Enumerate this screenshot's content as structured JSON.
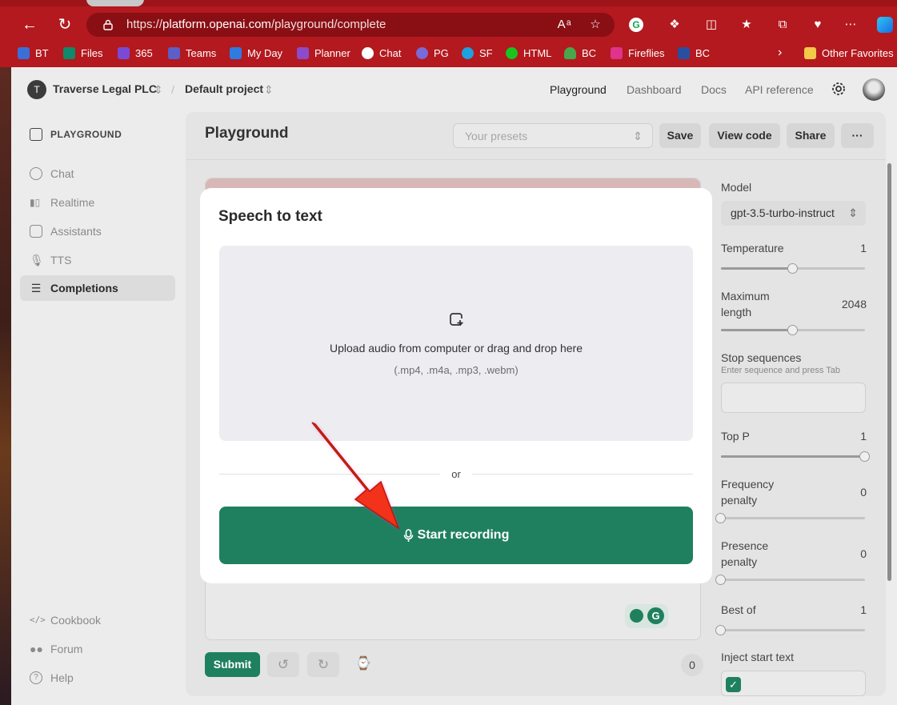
{
  "browser": {
    "url_prefix": "https://",
    "url_host": "platform.openai.com",
    "url_path": "/playground/complete",
    "favorites": [
      {
        "label": "BT",
        "color": "#3b6fd8"
      },
      {
        "label": "Files",
        "color": "#0f8a6a"
      },
      {
        "label": "365",
        "color": "#7a4ad6"
      },
      {
        "label": "Teams",
        "color": "#5b5fc7"
      },
      {
        "label": "My Day",
        "color": "#2f7be0"
      },
      {
        "label": "Planner",
        "color": "#8c4cc9"
      },
      {
        "label": "Chat",
        "color": "#ffffff"
      },
      {
        "label": "PG",
        "color": "#7a6ad8"
      },
      {
        "label": "SF",
        "color": "#1fa0e0"
      },
      {
        "label": "HTML",
        "color": "#18c41e"
      },
      {
        "label": "BC",
        "color": "#4aa64a"
      },
      {
        "label": "Fireflies",
        "color": "#e0338a"
      },
      {
        "label": "BC",
        "color": "#2a4fa0"
      }
    ],
    "other_favorites": "Other Favorites"
  },
  "header": {
    "org_initial": "T",
    "org_name": "Traverse Legal PLC",
    "separator": "/",
    "project": "Default project",
    "nav": [
      "Playground",
      "Dashboard",
      "Docs",
      "API reference"
    ]
  },
  "sidebar": {
    "section_label": "PLAYGROUND",
    "items": [
      {
        "label": "Chat",
        "icon": "chat-bubble-icon"
      },
      {
        "label": "Realtime",
        "icon": "audio-wave-icon"
      },
      {
        "label": "Assistants",
        "icon": "robot-icon"
      },
      {
        "label": "TTS",
        "icon": "microphone-icon"
      },
      {
        "label": "Completions",
        "icon": "lines-icon",
        "active": true
      }
    ],
    "footer": [
      {
        "label": "Cookbook",
        "icon": "code-icon"
      },
      {
        "label": "Forum",
        "icon": "people-icon"
      },
      {
        "label": "Help",
        "icon": "help-icon"
      }
    ]
  },
  "main": {
    "title": "Playground",
    "presets_placeholder": "Your presets",
    "buttons": {
      "save": "Save",
      "view_code": "View code",
      "share": "Share",
      "more": "···"
    },
    "submit": "Submit",
    "token_count": "0"
  },
  "settings": {
    "model_label": "Model",
    "model_value": "gpt-3.5-turbo-instruct",
    "temperature": {
      "label": "Temperature",
      "value": "1",
      "level": 0.5
    },
    "max_length": {
      "label_line1": "Maximum",
      "label_line2": "length",
      "value": "2048",
      "level": 0.5
    },
    "stop_sequences": {
      "label": "Stop sequences",
      "hint": "Enter sequence and press Tab"
    },
    "top_p": {
      "label": "Top P",
      "value": "1",
      "level": 1.0
    },
    "frequency_penalty": {
      "label_line1": "Frequency",
      "label_line2": "penalty",
      "value": "0",
      "level": 0.0
    },
    "presence_penalty": {
      "label_line1": "Presence",
      "label_line2": "penalty",
      "value": "0",
      "level": 0.0
    },
    "best_of": {
      "label": "Best of",
      "value": "1",
      "level": 0.0
    },
    "inject_start": {
      "label": "Inject start text",
      "checked": true
    }
  },
  "modal": {
    "title": "Speech to text",
    "upload_text": "Upload audio from computer or drag and drop here",
    "formats": "(.mp4, .m4a, .mp3, .webm)",
    "or": "or",
    "record_label": "Start recording",
    "record_color": "#1f8060"
  }
}
